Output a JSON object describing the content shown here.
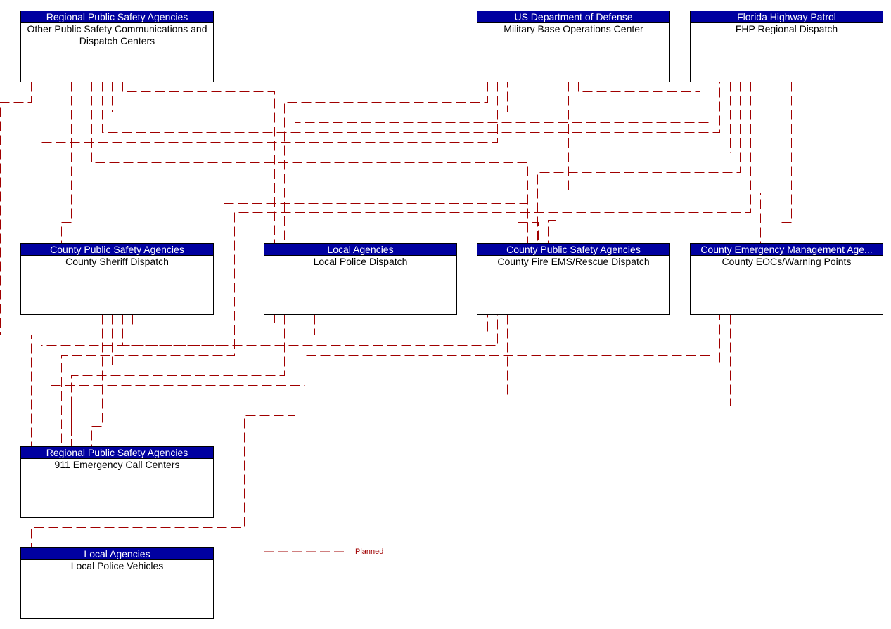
{
  "diagram": {
    "line_color": "#a00000",
    "header_color": "#0000a0",
    "nodes": [
      {
        "id": "other_ps",
        "header": "Regional Public Safety Agencies",
        "name": "Other Public Safety Communications and Dispatch Centers"
      },
      {
        "id": "military",
        "header": "US Department of Defense",
        "name": "Military Base Operations Center"
      },
      {
        "id": "fhp",
        "header": "Florida Highway Patrol",
        "name": "FHP Regional Dispatch"
      },
      {
        "id": "sheriff",
        "header": "County Public Safety Agencies",
        "name": "County Sheriff Dispatch"
      },
      {
        "id": "local_police",
        "header": "Local Agencies",
        "name": "Local Police Dispatch"
      },
      {
        "id": "fire",
        "header": "County Public Safety Agencies",
        "name": "County Fire EMS/Rescue Dispatch"
      },
      {
        "id": "eoc",
        "header": "County Emergency Management Age...",
        "name": "County EOCs/Warning Points"
      },
      {
        "id": "e911",
        "header": "Regional Public Safety Agencies",
        "name": "911 Emergency Call Centers"
      },
      {
        "id": "vehicles",
        "header": "Local Agencies",
        "name": "Local Police Vehicles"
      }
    ],
    "connections": [
      {
        "from": "other_ps",
        "to": "e911",
        "status": "Planned"
      },
      {
        "from": "other_ps",
        "to": "sheriff",
        "status": "Planned"
      },
      {
        "from": "other_ps",
        "to": "eoc",
        "status": "Planned"
      },
      {
        "from": "other_ps",
        "to": "fire",
        "status": "Planned"
      },
      {
        "from": "other_ps",
        "to": "fhp",
        "status": "Planned"
      },
      {
        "from": "other_ps",
        "to": "military",
        "status": "Planned"
      },
      {
        "from": "other_ps",
        "to": "local_police",
        "status": "Planned"
      },
      {
        "from": "military",
        "to": "local_police",
        "status": "Planned"
      },
      {
        "from": "military",
        "to": "sheriff",
        "status": "Planned"
      },
      {
        "from": "military",
        "to": "fire",
        "status": "Planned"
      },
      {
        "from": "military",
        "to": "eoc",
        "status": "Planned"
      },
      {
        "from": "military",
        "to": "fhp",
        "status": "Planned"
      },
      {
        "from": "military",
        "to": "e911",
        "status": "Planned"
      },
      {
        "from": "fhp",
        "to": "sheriff",
        "status": "Planned"
      },
      {
        "from": "fhp",
        "to": "local_police",
        "status": "Planned"
      },
      {
        "from": "fhp",
        "to": "fire",
        "status": "Planned"
      },
      {
        "from": "fhp",
        "to": "eoc",
        "status": "Planned"
      },
      {
        "from": "fhp",
        "to": "e911",
        "status": "Planned"
      },
      {
        "from": "sheriff",
        "to": "local_police",
        "status": "Planned"
      },
      {
        "from": "sheriff",
        "to": "e911",
        "status": "Planned"
      },
      {
        "from": "sheriff",
        "to": "fire",
        "status": "Planned"
      },
      {
        "from": "sheriff",
        "to": "eoc",
        "status": "Planned"
      },
      {
        "from": "local_police",
        "to": "fire",
        "status": "Planned"
      },
      {
        "from": "local_police",
        "to": "eoc",
        "status": "Planned"
      },
      {
        "from": "local_police",
        "to": "e911",
        "status": "Planned"
      },
      {
        "from": "local_police",
        "to": "vehicles",
        "status": "Planned"
      },
      {
        "from": "fire",
        "to": "eoc",
        "status": "Planned"
      },
      {
        "from": "fire",
        "to": "e911",
        "status": "Planned"
      },
      {
        "from": "eoc",
        "to": "e911",
        "status": "Planned"
      }
    ]
  },
  "legend": {
    "planned_label": "Planned"
  }
}
